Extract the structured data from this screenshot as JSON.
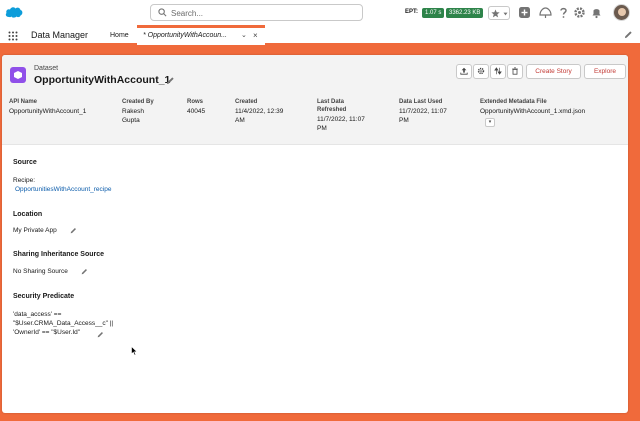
{
  "header": {
    "search_placeholder": "Search...",
    "ept_label": "EPT:",
    "ept_value": "1.07 s",
    "size_value": "3362.23 KB"
  },
  "nav": {
    "app_name": "Data Manager",
    "home_tab": "Home",
    "active_tab": "* OpportunityWithAccoun..."
  },
  "record": {
    "object_type": "Dataset",
    "title": "OpportunityWithAccount_1",
    "create_story_label": "Create Story",
    "explore_label": "Explore"
  },
  "fields": [
    {
      "label": "API Name",
      "value": "OpportunityWithAccount_1"
    },
    {
      "label": "Created By",
      "value": "Rakesh\nGupta"
    },
    {
      "label": "Rows",
      "value": "40045"
    },
    {
      "label": "Created",
      "value": "11/4/2022, 12:39\nAM"
    },
    {
      "label": "Last Data\nRefreshed",
      "value": "11/7/2022, 11:07\nPM"
    },
    {
      "label": "Data Last Used",
      "value": "11/7/2022, 11:07\nPM"
    },
    {
      "label": "Extended Metadata File",
      "value": "OpportunityWithAccount_1.xmd.json"
    }
  ],
  "sections": {
    "source_title": "Source",
    "recipe_label": "Recipe:",
    "recipe_link": "OpportunitiesWithAccount_recipe",
    "location_title": "Location",
    "location_value": "My Private App",
    "sharing_title": "Sharing Inheritance Source",
    "sharing_value": "No Sharing Source",
    "predicate_title": "Security Predicate",
    "predicate_value": "'data_access' ==\n\"$User.CRMA_Data_Access__c\" ||\n'OwnerId' == \"$User.Id\""
  },
  "colors": {
    "accent": "#f06a3b",
    "dataset_icon": "#9050e9",
    "link": "#0b5cab",
    "badge": "#2e844a"
  },
  "icons": [
    "salesforce-cloud-icon",
    "search-icon",
    "star-icon",
    "add-icon",
    "help-icon",
    "setup-icon",
    "notification-bell-icon",
    "dataset-icon",
    "pencil-icon",
    "upload-icon",
    "settings-icon",
    "sort-icon",
    "delete-icon",
    "app-launcher-icon",
    "cursor-icon"
  ]
}
